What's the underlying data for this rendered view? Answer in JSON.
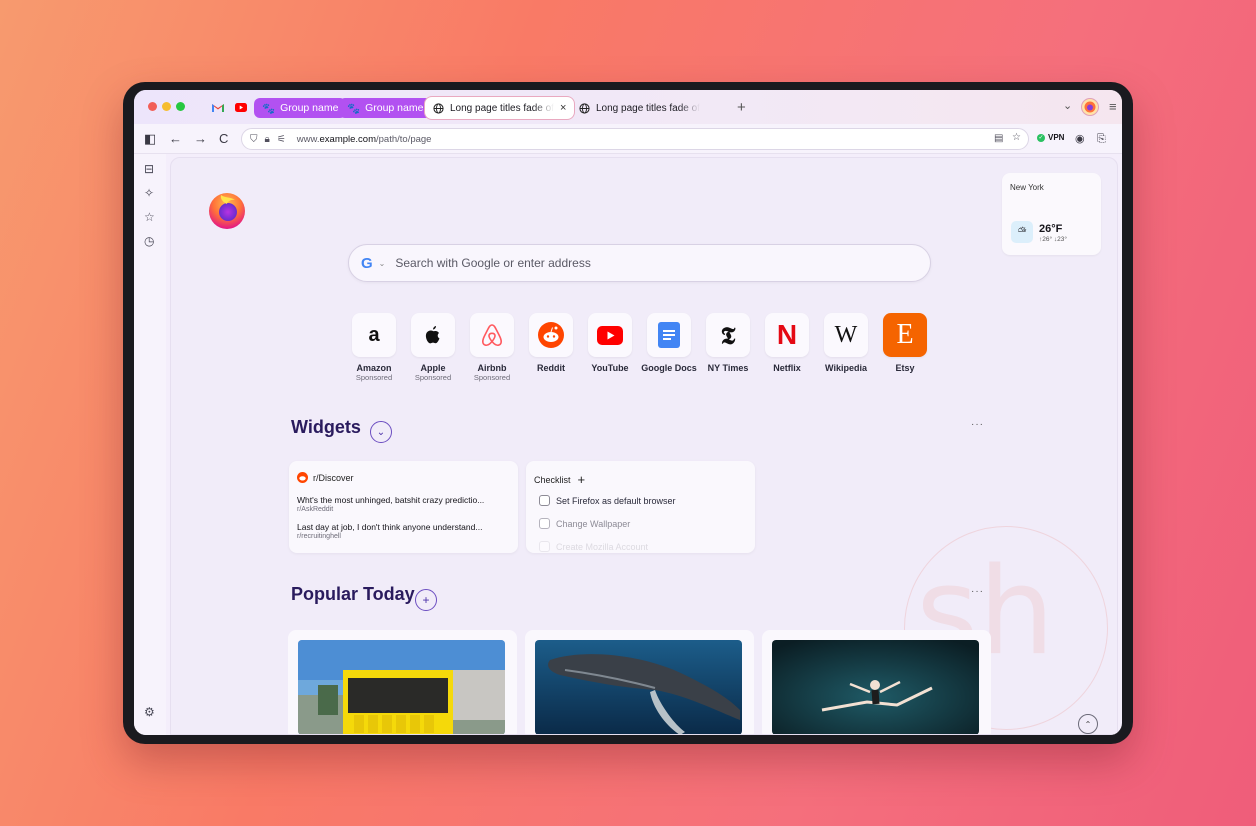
{
  "tabs": {
    "group1": "Group name",
    "group2": "Group name",
    "active_tab": "Long page titles fade off",
    "tab2": "Long page titles fade off",
    "new_tab": "+",
    "close": "×"
  },
  "nav": {
    "url_prefix": "www.",
    "url_domain": "example.com",
    "url_path": "/path/to/page",
    "vpn": "VPN"
  },
  "weather": {
    "city": "New York",
    "temp": "26°F",
    "high": "↑26°",
    "low": "↓23°"
  },
  "search": {
    "engine_letter": "G",
    "placeholder": "Search with Google or enter address"
  },
  "shortcuts": [
    {
      "label": "Amazon",
      "sub": "Sponsored"
    },
    {
      "label": "Apple",
      "sub": "Sponsored"
    },
    {
      "label": "Airbnb",
      "sub": "Sponsored"
    },
    {
      "label": "Reddit",
      "sub": ""
    },
    {
      "label": "YouTube",
      "sub": ""
    },
    {
      "label": "Google Docs",
      "sub": ""
    },
    {
      "label": "NY Times",
      "sub": ""
    },
    {
      "label": "Netflix",
      "sub": ""
    },
    {
      "label": "Wikipedia",
      "sub": ""
    },
    {
      "label": "Etsy",
      "sub": ""
    }
  ],
  "widgets": {
    "title": "Widgets",
    "more": "···",
    "reddit": {
      "subreddit": "r/Discover",
      "posts": [
        {
          "title": "Wht's the most unhinged, batshit crazy predictio...",
          "sub": "r/AskReddit"
        },
        {
          "title": "Last day at job, I don't think anyone understand...",
          "sub": "r/recruitinghell"
        }
      ]
    },
    "checklist": {
      "title": "Checklist",
      "add": "+",
      "items": [
        "Set Firefox as default browser",
        "Change Wallpaper",
        "Create Mozilla Account"
      ]
    }
  },
  "popular": {
    "title": "Popular Today",
    "add": "+",
    "more": "···"
  },
  "icons": {
    "amazon": "a",
    "wikipedia": "W",
    "etsy": "E",
    "netflix": "N",
    "nytimes": "𝕿",
    "apple": "",
    "scroll_up": "⌃"
  },
  "colors": {
    "group_chip": "#b251f1",
    "accent": "#6c4ec1",
    "vpn": "#2ac161"
  }
}
